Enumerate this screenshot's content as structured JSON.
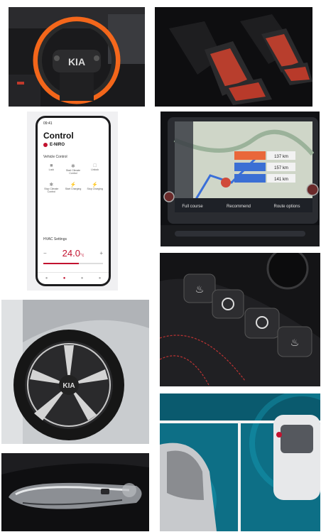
{
  "phone_app": {
    "time": "09:41",
    "title": "Control",
    "car_name": "E-NIRO",
    "section_vehicle": "Vehicle Control",
    "controls": [
      {
        "label": "Lock",
        "icon": "lock-icon"
      },
      {
        "label": "Start Climate Control",
        "icon": "fan-icon"
      },
      {
        "label": "Unlock",
        "icon": "unlock-icon"
      },
      {
        "label": "Stop Climate Control",
        "icon": "fan-icon"
      },
      {
        "label": "Start Charging",
        "icon": "plug-icon"
      },
      {
        "label": "Stop Charging",
        "icon": "plug-icon"
      }
    ],
    "section_hvac": "HVAC Settings",
    "temperature": "24.0",
    "temperature_unit": "°c",
    "minus": "−",
    "plus": "+"
  },
  "nav_screen": {
    "buttons": [
      "Full course",
      "Recommend",
      "Route options"
    ],
    "route_boxes": [
      "137 km",
      "157 km",
      "141 km"
    ]
  },
  "colors": {
    "accent_orange": "#ff6a1a",
    "kia_red": "#c2122f",
    "seat_red": "#c8402e",
    "parking_cyan": "#18a9c4"
  }
}
